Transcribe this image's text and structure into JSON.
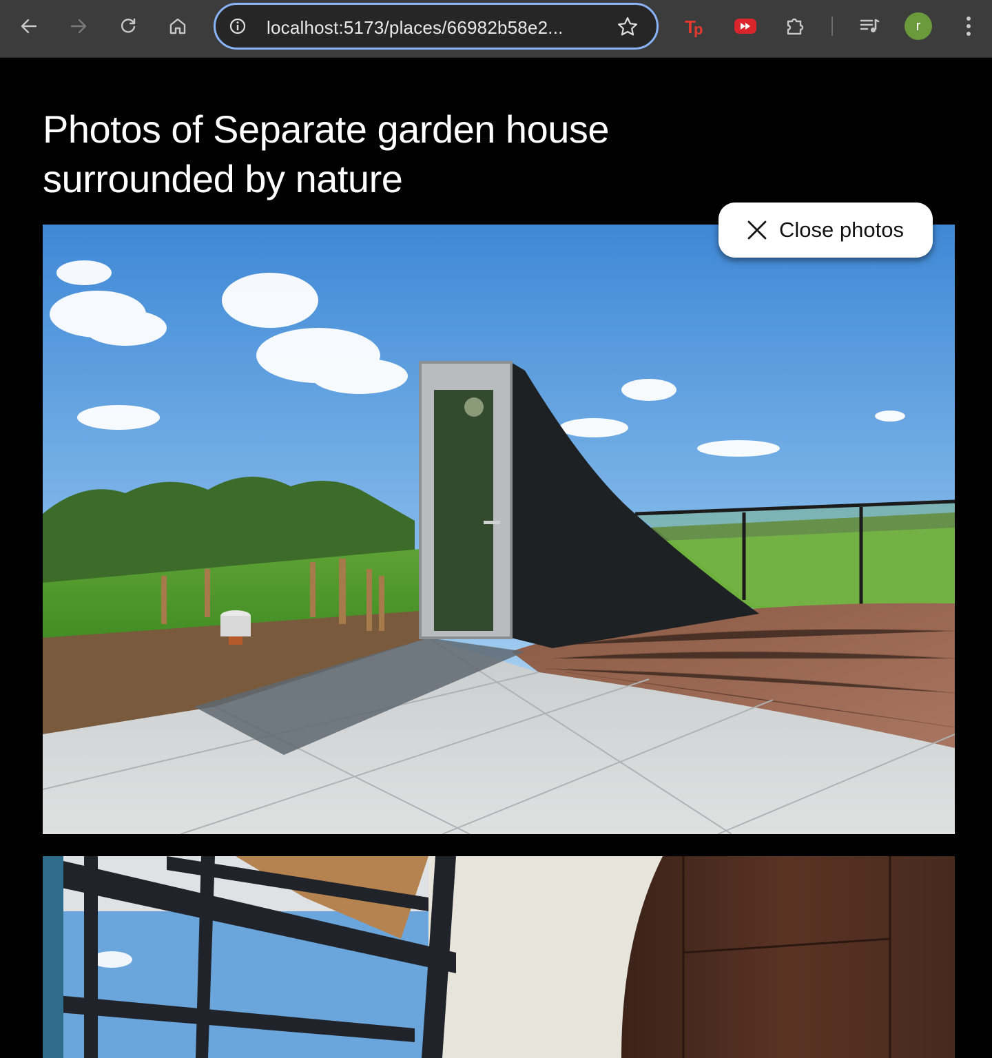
{
  "browser": {
    "url": "localhost:5173/places/66982b58e2...",
    "profile_initial": "r",
    "extensions": [
      "tp-extension-icon",
      "fast-forward-extension-icon",
      "puzzle-icon",
      "media-queue-icon"
    ]
  },
  "page": {
    "title": "Photos of Separate garden house surrounded by nature",
    "close_label": "Close photos"
  },
  "photos": [
    {
      "name": "photo-garden-house-exterior"
    },
    {
      "name": "photo-garden-house-interior"
    }
  ]
}
